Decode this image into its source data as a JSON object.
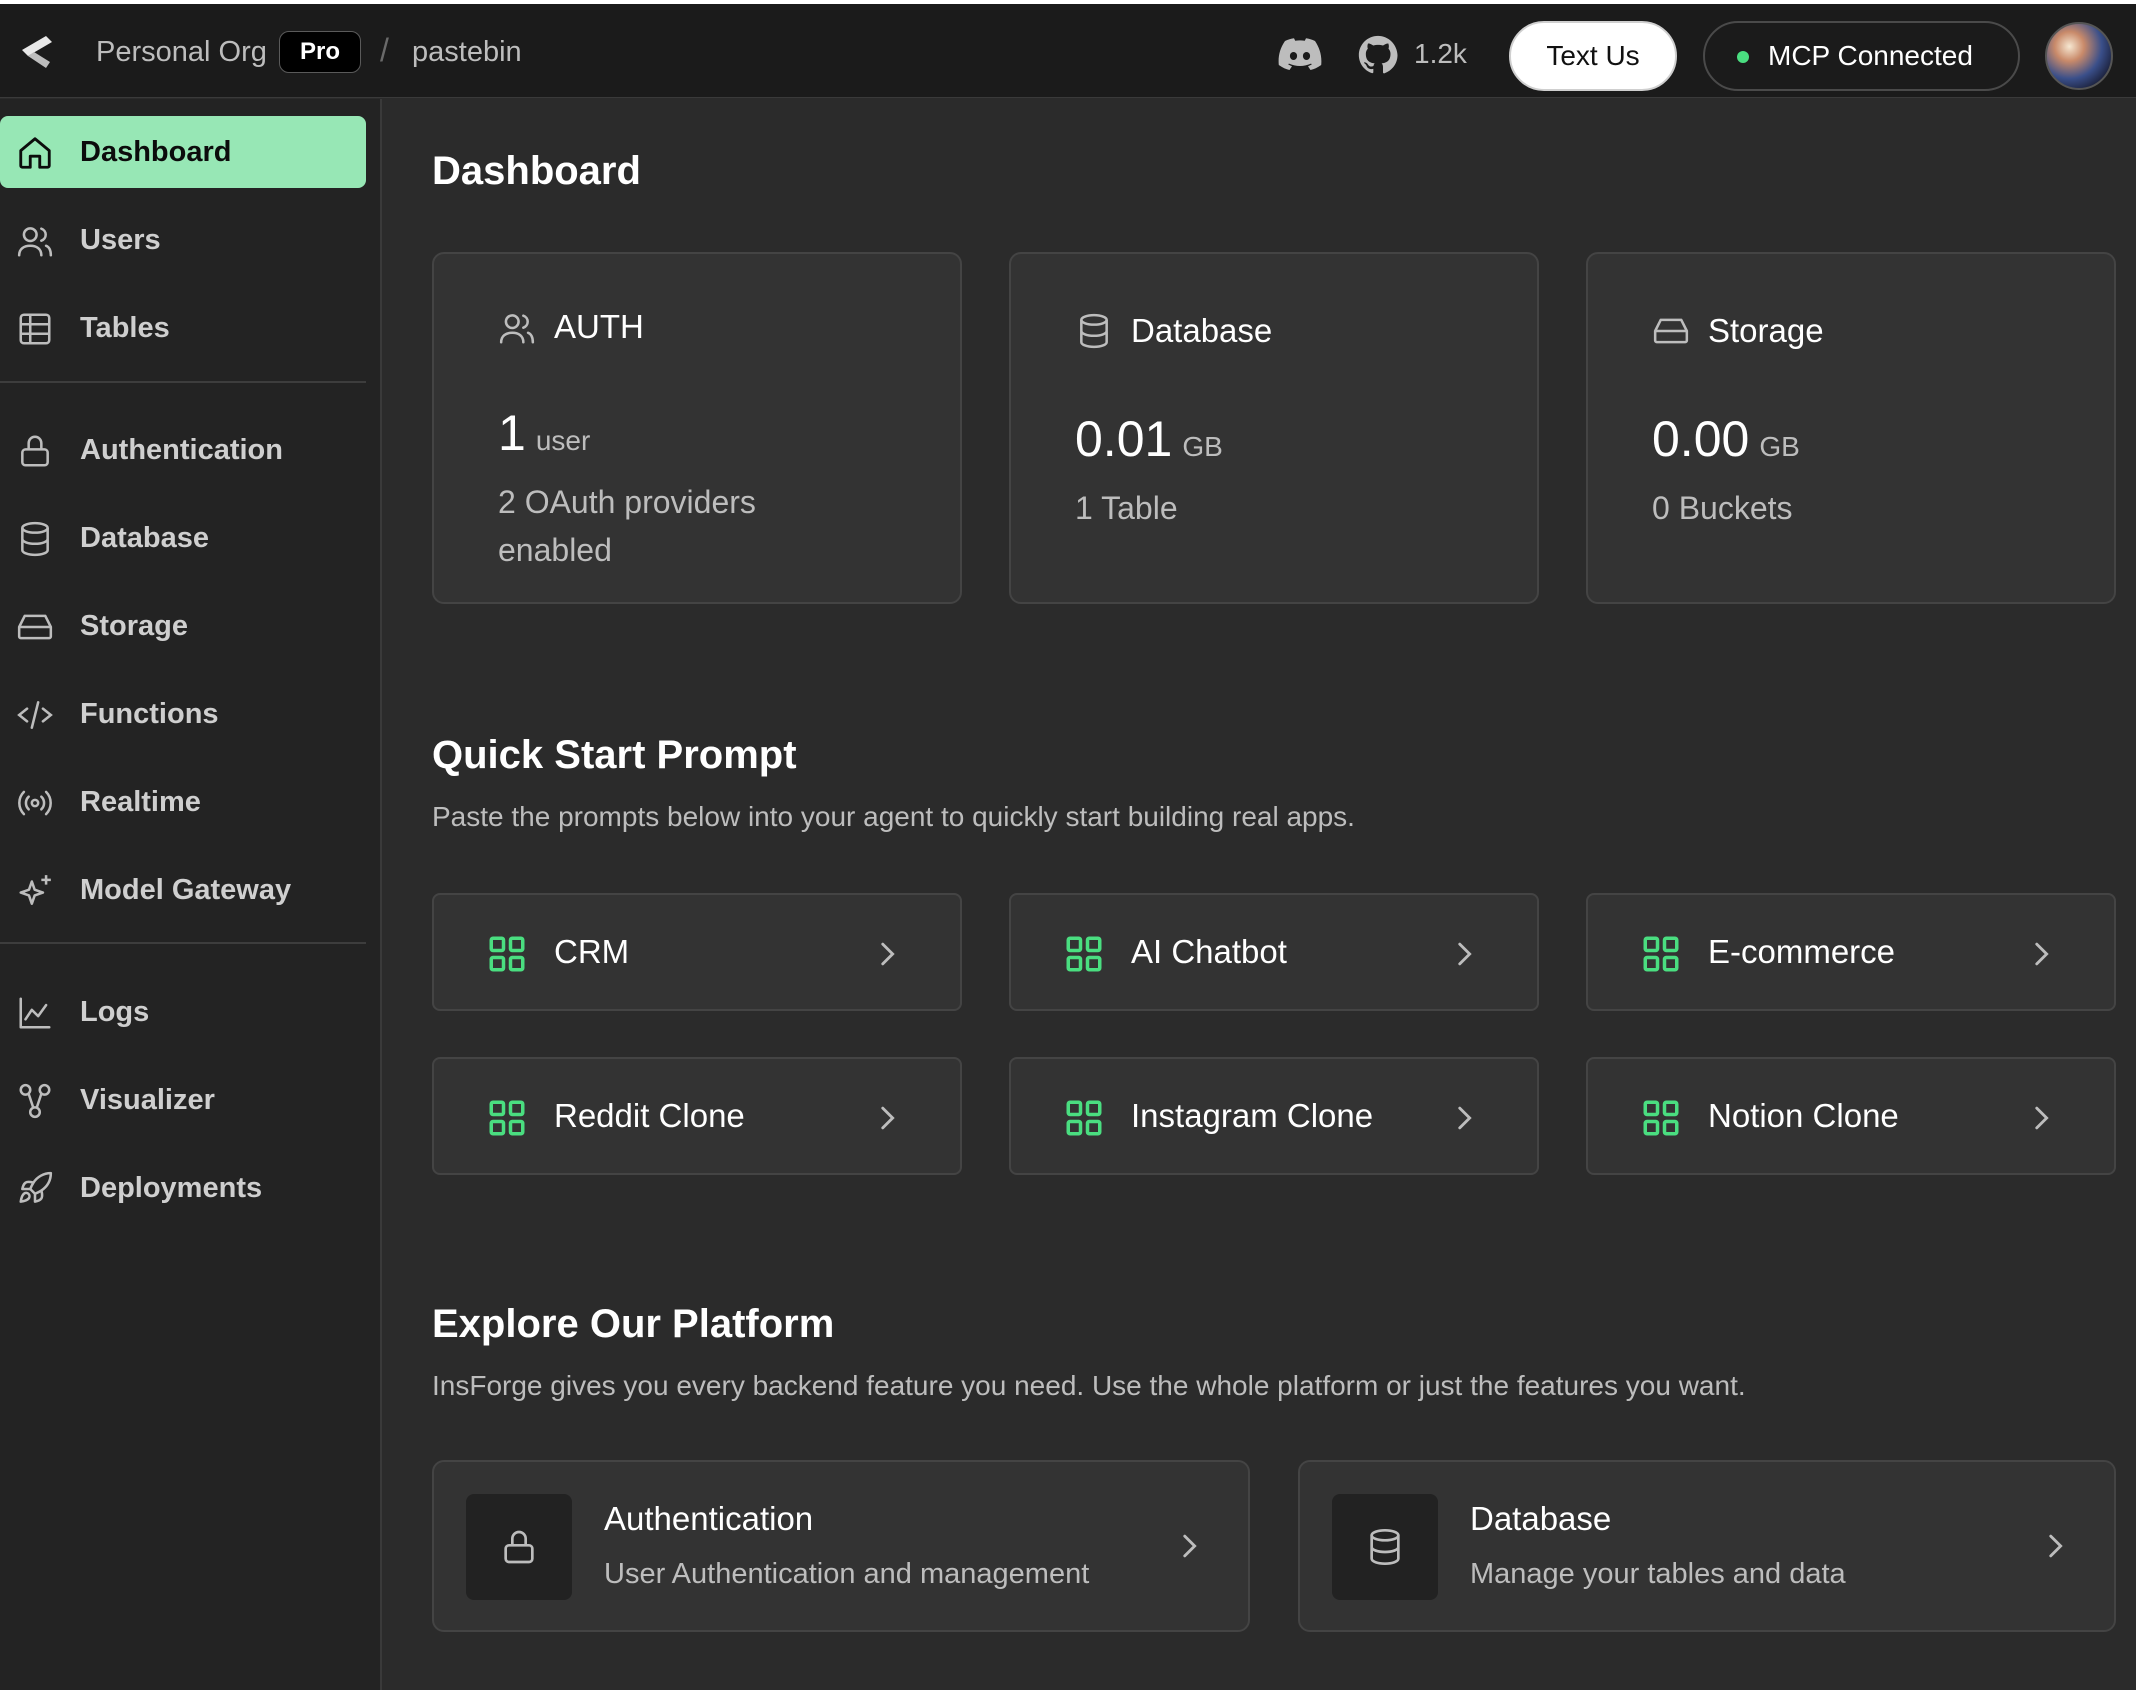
{
  "topbar": {
    "org_name": "Personal Org",
    "plan_badge": "Pro",
    "separator": "/",
    "project_name": "pastebin",
    "github_stars": "1.2k",
    "text_us_label": "Text Us",
    "mcp_status_label": "MCP Connected",
    "mcp_status_color": "#4ade80"
  },
  "sidebar": {
    "items": [
      {
        "label": "Dashboard",
        "icon": "home-icon",
        "active": true
      },
      {
        "label": "Users",
        "icon": "users-icon"
      },
      {
        "label": "Tables",
        "icon": "table-icon"
      },
      {
        "label": "Authentication",
        "icon": "lock-icon"
      },
      {
        "label": "Database",
        "icon": "database-icon"
      },
      {
        "label": "Storage",
        "icon": "storage-icon"
      },
      {
        "label": "Functions",
        "icon": "code-icon"
      },
      {
        "label": "Realtime",
        "icon": "broadcast-icon"
      },
      {
        "label": "Model Gateway",
        "icon": "sparkles-icon"
      },
      {
        "label": "Logs",
        "icon": "chart-line-icon"
      },
      {
        "label": "Visualizer",
        "icon": "graph-icon"
      },
      {
        "label": "Deployments",
        "icon": "rocket-icon"
      }
    ],
    "accent_color": "#97e7b5"
  },
  "main": {
    "page_title": "Dashboard",
    "stats": [
      {
        "title": "AUTH",
        "value": "1",
        "unit": "user",
        "sub": "2 OAuth providers enabled"
      },
      {
        "title": "Database",
        "value": "0.01",
        "unit": "GB",
        "sub": "1 Table"
      },
      {
        "title": "Storage",
        "value": "0.00",
        "unit": "GB",
        "sub": "0 Buckets"
      }
    ],
    "quick_start": {
      "title": "Quick Start Prompt",
      "description": "Paste the prompts below into your agent to quickly start building real apps.",
      "prompts": [
        "CRM",
        "AI Chatbot",
        "E-commerce",
        "Reddit Clone",
        "Instagram Clone",
        "Notion Clone"
      ]
    },
    "explore": {
      "title": "Explore Our Platform",
      "description": "InsForge gives you every backend feature you need. Use the whole platform or just the features you want.",
      "cards": [
        {
          "title": "Authentication",
          "description": "User Authentication and management",
          "icon": "lock-icon"
        },
        {
          "title": "Database",
          "description": "Manage your tables and data",
          "icon": "database-icon"
        }
      ]
    }
  }
}
